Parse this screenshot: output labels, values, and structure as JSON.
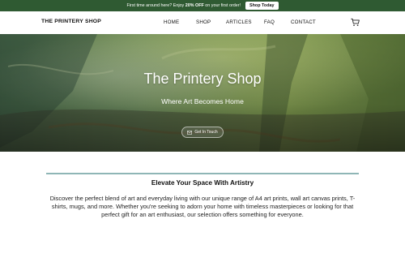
{
  "promo": {
    "text_prefix": "First time around here? Enjoy ",
    "text_bold": "20% OFF",
    "text_suffix": " on your first order!",
    "button_label": "Shop Today",
    "background": "#2f5a32"
  },
  "header": {
    "logo": "THE PRINTERY SHOP",
    "menu": [
      {
        "label": "HOME"
      },
      {
        "label": "SHOP"
      },
      {
        "label": "ARTICLES"
      },
      {
        "label": "FAQ"
      },
      {
        "label": "CONTACT"
      }
    ],
    "cart_icon": "cart-icon"
  },
  "hero": {
    "title": "The Printery Shop",
    "subtitle": "Where Art Becomes Home",
    "cta_label": "Get In Touch",
    "cta_icon": "envelope-icon"
  },
  "intro": {
    "title": "Elevate Your Space With Artistry",
    "body": "Discover the perfect blend of art and everyday living with our unique range of A4 art prints, wall art canvas prints, T-shirts, mugs, and more. Whether you're seeking to adorn your home with timeless masterpieces or looking for that perfect gift for an art enthusiast, our selection offers something for everyone.",
    "accent": "#8fb6b6"
  }
}
